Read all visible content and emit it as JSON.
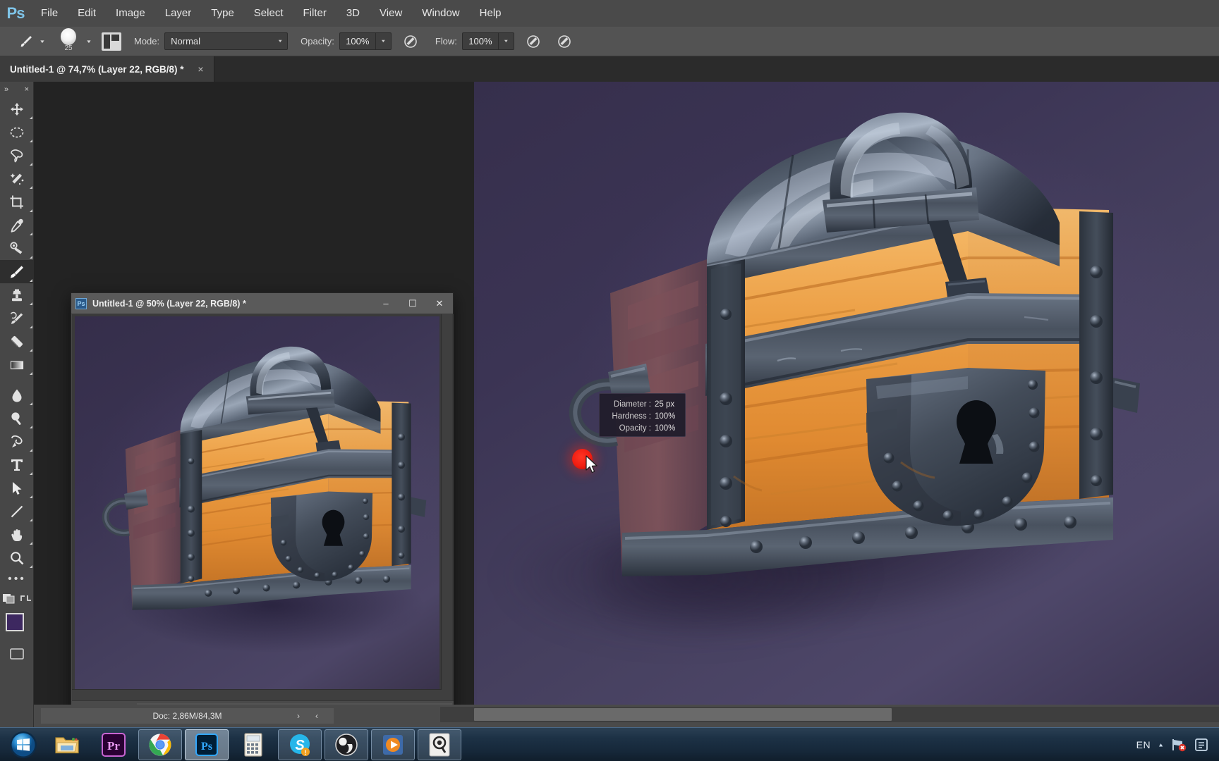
{
  "app": {
    "name": "Adobe Photoshop",
    "logo_text": "Ps"
  },
  "menubar": {
    "items": [
      {
        "label": "File"
      },
      {
        "label": "Edit"
      },
      {
        "label": "Image"
      },
      {
        "label": "Layer"
      },
      {
        "label": "Type"
      },
      {
        "label": "Select"
      },
      {
        "label": "Filter"
      },
      {
        "label": "3D"
      },
      {
        "label": "View"
      },
      {
        "label": "Window"
      },
      {
        "label": "Help"
      }
    ]
  },
  "options_bar": {
    "tool_icon": "brush-icon",
    "brush_size_label": "25",
    "mode_label": "Mode:",
    "mode_value": "Normal",
    "opacity_label": "Opacity:",
    "opacity_value": "100%",
    "flow_label": "Flow:",
    "flow_value": "100%"
  },
  "document_tab": {
    "title": "Untitled-1 @ 74,7% (Layer 22, RGB/8) *",
    "close": "×"
  },
  "toolbar": {
    "collapse": "»",
    "close": "×",
    "tools": [
      {
        "name": "move-tool"
      },
      {
        "name": "marquee-tool"
      },
      {
        "name": "lasso-tool"
      },
      {
        "name": "magic-wand-tool"
      },
      {
        "name": "crop-tool"
      },
      {
        "name": "eyedropper-tool"
      },
      {
        "name": "healing-brush-tool"
      },
      {
        "name": "brush-tool"
      },
      {
        "name": "clone-stamp-tool"
      },
      {
        "name": "history-brush-tool"
      },
      {
        "name": "eraser-tool"
      },
      {
        "name": "gradient-tool"
      },
      {
        "name": "blur-tool"
      },
      {
        "name": "dodge-tool"
      },
      {
        "name": "pen-tool"
      },
      {
        "name": "type-tool"
      },
      {
        "name": "path-selection-tool"
      },
      {
        "name": "line-tool"
      },
      {
        "name": "hand-tool"
      },
      {
        "name": "zoom-tool"
      }
    ],
    "more_label": "•••",
    "foreground_color": "#3d2860",
    "background_color": "#ffffff"
  },
  "floating_window": {
    "title": "Untitled-1 @ 50% (Layer 22, RGB/8) *",
    "icon_letter": "Ps",
    "minimize": "–",
    "maximize": "☐",
    "close": "✕",
    "zoom_value": "50%",
    "doc_info": "Doc: 2,86M/84,3M",
    "doc_arrow": "›"
  },
  "brush_hud": {
    "rows": [
      {
        "key": "Diameter :",
        "value": "25 px"
      },
      {
        "key": "Hardness :",
        "value": "100%"
      },
      {
        "key": "Opacity :",
        "value": "100%"
      }
    ]
  },
  "main_status": {
    "doc_info": "Doc: 2,86M/84,3M",
    "arrow_right": "›",
    "arrow_left": "‹"
  },
  "artwork": {
    "description": "Stylized game-art treasure chest with domed metal lid, arched handle, orange wooden planks, riveted steel bands and a keyhole lock plate, on a purple backdrop",
    "metal_color": "#3d4553",
    "metal_highlight": "#8e9bae",
    "wood_color": "#e8963f",
    "wood_highlight": "#f7bd6b",
    "background_color": "#3f3858"
  },
  "taskbar": {
    "apps": [
      {
        "name": "start-orb",
        "label": ""
      },
      {
        "name": "file-explorer",
        "label": ""
      },
      {
        "name": "premiere-pro",
        "label": "Pr"
      },
      {
        "name": "google-chrome",
        "label": ""
      },
      {
        "name": "photoshop",
        "label": "Ps"
      },
      {
        "name": "calculator-notes",
        "label": ""
      },
      {
        "name": "skype",
        "label": "S"
      },
      {
        "name": "obs-studio",
        "label": ""
      },
      {
        "name": "media-player",
        "label": ""
      },
      {
        "name": "search-app",
        "label": ""
      }
    ],
    "tray": {
      "language": "EN",
      "show_hidden": "▲"
    }
  }
}
